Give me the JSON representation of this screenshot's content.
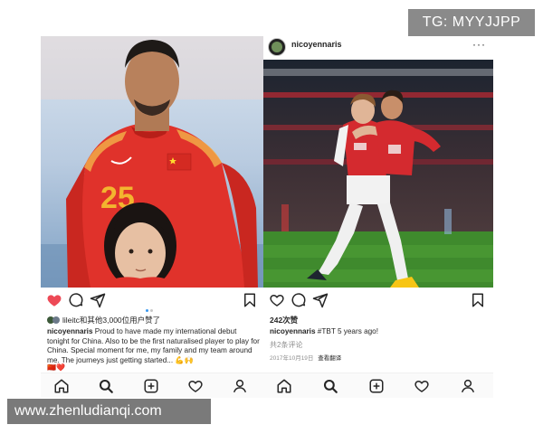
{
  "watermarks": {
    "top": "TG: MYYJJPP",
    "bottom": "www.zhenludianqi.com"
  },
  "left_post": {
    "photo": "player-and-child-photo",
    "jersey_number": "25",
    "liked_by": "lileitc和其他3,000位用户赞了",
    "caption_username": "nicoyennaris",
    "caption_text": "Proud to have made my international debut tonight for China. Also to be the first naturalised player to play for China. Special moment for me, my family and my team around me. The journeys just getting started...",
    "caption_emoji": "💪🙌",
    "flags": "🇨🇳❤️",
    "icons": {
      "like": "heart-filled-icon",
      "comment": "comment-icon",
      "share": "send-icon",
      "save": "bookmark-icon"
    },
    "colors": {
      "like": "#ed4956"
    }
  },
  "right_post": {
    "username": "nicoyennaris",
    "more": "···",
    "photo": "celebration-photo",
    "likes": "242次赞",
    "caption_username": "nicoyennaris",
    "caption_text": "#TBT 5 years ago!",
    "comments": "共2条评论",
    "date": "2017年10月19日",
    "translate": "查看翻译",
    "icons": {
      "like": "heart-outline-icon",
      "comment": "comment-icon",
      "share": "send-icon",
      "save": "bookmark-icon"
    }
  },
  "tabbar": {
    "items": [
      "home-icon",
      "search-icon",
      "add-icon",
      "activity-icon",
      "profile-icon"
    ]
  }
}
